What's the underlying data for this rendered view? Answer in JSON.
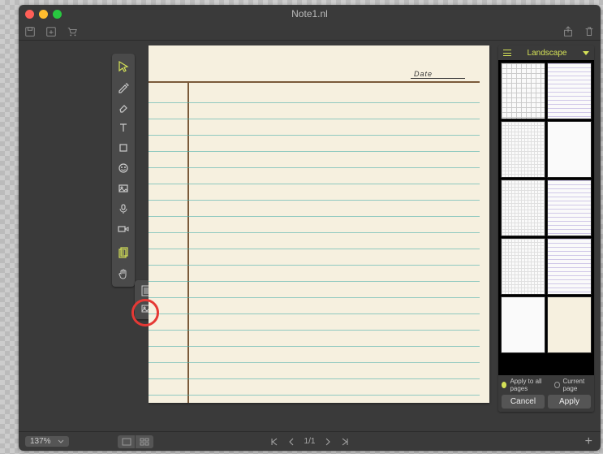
{
  "window": {
    "title": "Note1.nl"
  },
  "paper": {
    "date_label": "Date"
  },
  "rpanel": {
    "head_label": "Landscape",
    "radio_all": "Apply to all pages",
    "radio_current": "Current page",
    "btn_cancel": "Cancel",
    "btn_apply": "Apply"
  },
  "bottom": {
    "zoom": "137%",
    "page": "1/1"
  },
  "tools": {
    "select": "select",
    "pen": "pen",
    "eraser": "eraser",
    "text": "text",
    "shape": "shape",
    "emoji": "emoji",
    "image": "image",
    "audio": "audio",
    "video": "video",
    "template": "template",
    "hand": "hand"
  }
}
